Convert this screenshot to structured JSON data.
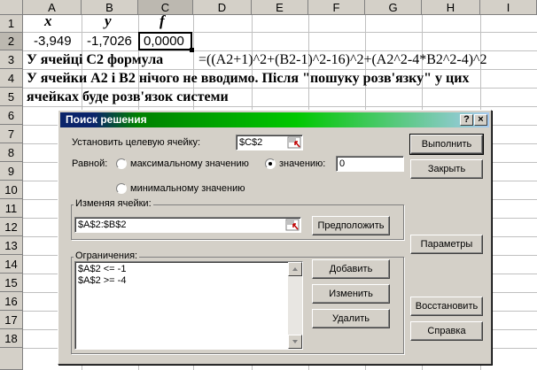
{
  "sheet": {
    "columns": [
      "A",
      "B",
      "C",
      "D",
      "E",
      "F",
      "G",
      "H",
      "I"
    ],
    "rows": [
      "1",
      "2",
      "3",
      "4",
      "5",
      "6",
      "7",
      "8",
      "9",
      "10",
      "11",
      "12",
      "13",
      "14",
      "15",
      "16",
      "17",
      "18"
    ],
    "headers": {
      "a1": "x",
      "b1": "y",
      "c1": "f"
    },
    "values": {
      "a2": "-3,949",
      "b2": "-1,7026",
      "c2": "0,0000"
    },
    "text": {
      "row3_label": "У ячейці С2 формула",
      "row3_formula": "=((A2+1)^2+(B2-1)^2-16)^2+(A2^2-4*B2^2-4)^2",
      "row4": "У ячейки А2 і В2 нічого не вводимо. Після \"пошуку розв'язку\" у цих",
      "row5": "ячейках буде розв'язок системи"
    }
  },
  "dialog": {
    "title": "Поиск решения",
    "help_glyph": "?",
    "close_glyph": "×",
    "target_label": "Установить целевую ячейку:",
    "target_value": "$C$2",
    "equal_label": "Равной:",
    "opt_max": "максимальному значению",
    "opt_value": "значению:",
    "value_field": "0",
    "opt_min": "минимальному значению",
    "changing_label": "Изменяя ячейки:",
    "changing_value": "$A$2:$B$2",
    "guess_button": "Предположить",
    "constraints_label": "Ограничения:",
    "constraints": [
      "$A$2 <= -1",
      "$A$2 >= -4"
    ],
    "add_button": "Добавить",
    "change_button": "Изменить",
    "delete_button": "Удалить",
    "solve_button": "Выполнить",
    "close_button": "Закрыть",
    "options_button": "Параметры",
    "reset_button": "Восстановить",
    "help_button": "Справка",
    "selected_option": "value"
  }
}
